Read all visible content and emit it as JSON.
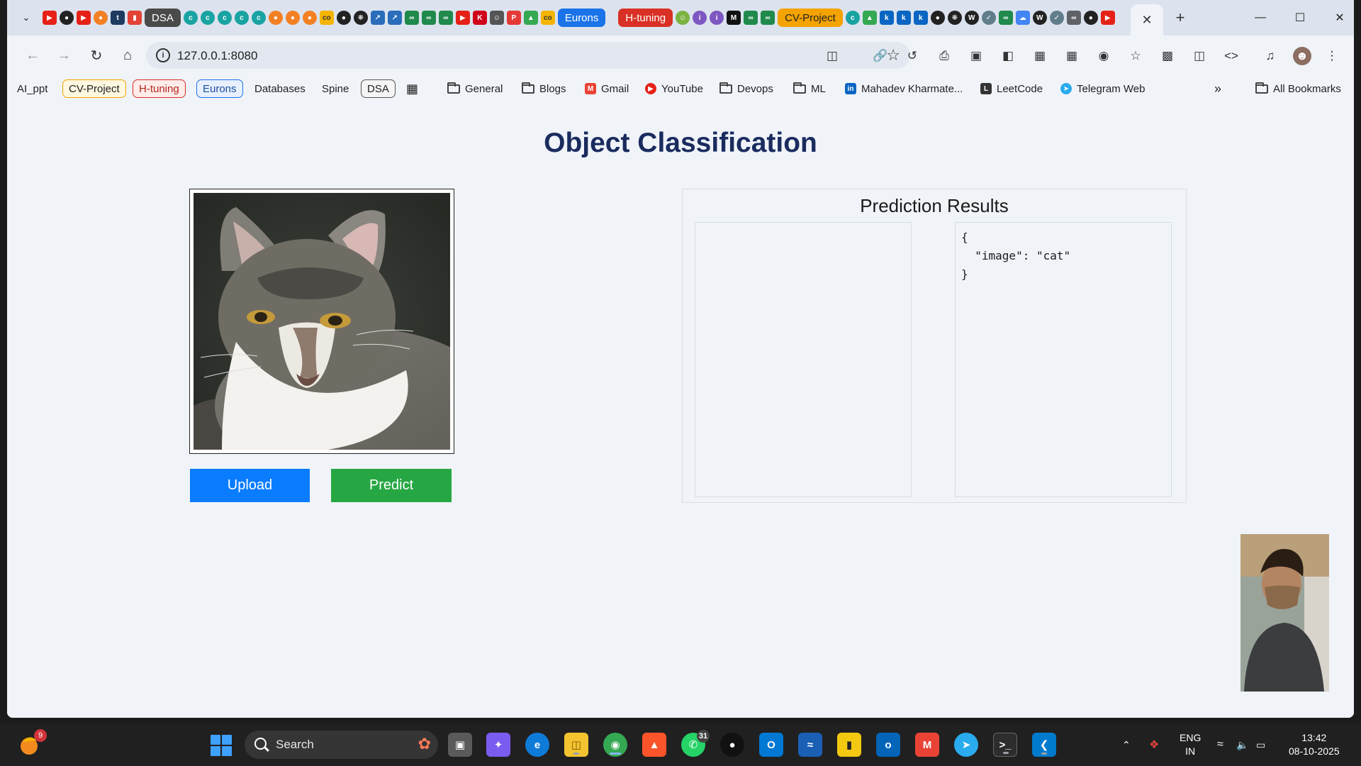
{
  "browser": {
    "pinned_tab_labels": [
      "DSA",
      "Eurons",
      "H-tuning",
      "CV-Project"
    ],
    "active_tab_close": "✕",
    "new_tab": "+",
    "url": "127.0.0.1:8080",
    "bookmarks": [
      "AI_ppt",
      "CV-Project",
      "H-tuning",
      "Eurons",
      "Databases",
      "Spine",
      "DSA",
      "General",
      "Blogs",
      "Gmail",
      "YouTube",
      "Devops",
      "ML",
      "Mahadev Kharmate...",
      "LeetCode",
      "Telegram Web"
    ],
    "more_bookmarks": "»",
    "all_bookmarks": "All Bookmarks"
  },
  "app": {
    "title": "Object Classification",
    "upload_label": "Upload",
    "predict_label": "Predict",
    "results_title": "Prediction Results",
    "json_output": "{\n  \"image\": \"cat\"\n}"
  },
  "taskbar": {
    "widget_badge": "9",
    "search_placeholder": "Search",
    "whatsapp_badge": "31",
    "lang_line1": "ENG",
    "lang_line2": "IN",
    "time": "13:42",
    "date": "08-10-2025"
  },
  "colors": {
    "title": "#1a2b5e",
    "upload_button": "#0a7cff",
    "predict_button": "#27a743",
    "page_background": "#f0f4f9"
  }
}
